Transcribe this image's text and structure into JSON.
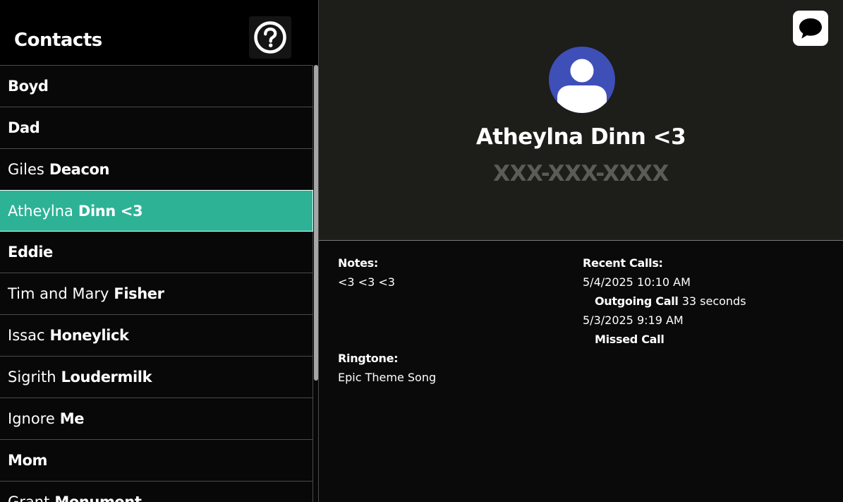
{
  "sidebar": {
    "title": "Contacts",
    "help_icon": "question-circle-icon",
    "contacts": [
      {
        "first": "",
        "last": "Boyd",
        "selected": false
      },
      {
        "first": "",
        "last": "Dad",
        "selected": false
      },
      {
        "first": "Giles",
        "last": "Deacon",
        "selected": false
      },
      {
        "first": "Atheylna",
        "last": "Dinn <3",
        "selected": true
      },
      {
        "first": "",
        "last": "Eddie",
        "selected": false
      },
      {
        "first": "Tim and Mary",
        "last": "Fisher",
        "selected": false
      },
      {
        "first": "Issac",
        "last": "Honeylick",
        "selected": false
      },
      {
        "first": "Sigrith",
        "last": "Loudermilk",
        "selected": false
      },
      {
        "first": "Ignore",
        "last": "Me",
        "selected": false
      },
      {
        "first": "",
        "last": "Mom",
        "selected": false
      },
      {
        "first": "Grant",
        "last": "Monument",
        "selected": false
      }
    ]
  },
  "detail": {
    "message_icon": "speech-bubble-icon",
    "avatar_icon": "person-avatar-icon",
    "name": "Atheylna Dinn <3",
    "phone": "XXX-XXX-XXXX",
    "notes_label": "Notes:",
    "notes_value": "<3 <3 <3",
    "ringtone_label": "Ringtone:",
    "ringtone_value": "Epic Theme Song",
    "recent_calls_label": "Recent Calls:",
    "recent_calls": [
      {
        "datetime": "5/4/2025 10:10 AM",
        "type": "Outgoing Call",
        "duration": "33 seconds"
      },
      {
        "datetime": "5/3/2025 9:19 AM",
        "type": "Missed Call",
        "duration": ""
      }
    ]
  },
  "colors": {
    "selected_row": "#2db296",
    "avatar": "#3f4fb8",
    "header_bg": "#1d1d19",
    "phone_placeholder": "#5b5b58"
  }
}
